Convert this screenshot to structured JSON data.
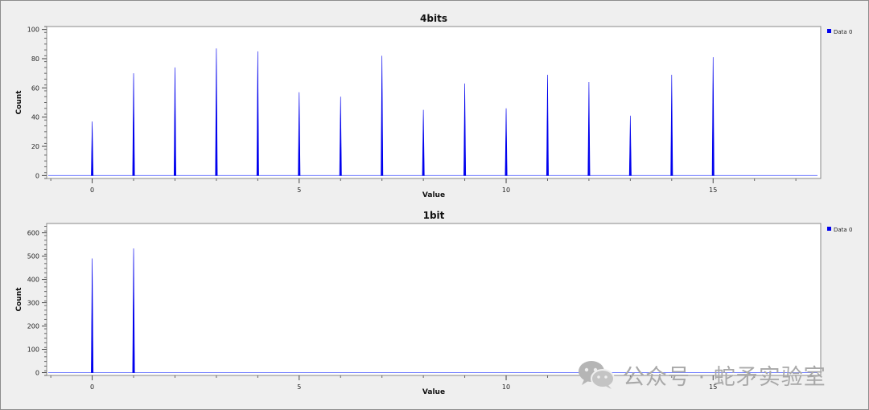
{
  "colors": {
    "series": "#0000ee",
    "baseline": "#6f7cff",
    "legend_marker": "#0000ee"
  },
  "watermark": {
    "icon": "wechat-icon",
    "text": "公众号 · 蛇矛实验室"
  },
  "chart_data": [
    {
      "type": "bar",
      "title": "4bits",
      "xlabel": "Value",
      "ylabel": "Count",
      "legend": [
        "Data 0"
      ],
      "legend_position": "top-right",
      "x_ticks": [
        0,
        5,
        10,
        15
      ],
      "y_ticks": [
        0,
        20,
        40,
        60,
        80,
        100
      ],
      "xlim": [
        -1.1,
        17.6
      ],
      "ylim": [
        -2,
        102
      ],
      "series": [
        {
          "name": "Data 0",
          "x": [
            0,
            1,
            2,
            3,
            4,
            5,
            6,
            7,
            8,
            9,
            10,
            11,
            12,
            13,
            14,
            15
          ],
          "values": [
            37,
            70,
            74,
            87,
            85,
            57,
            54,
            82,
            45,
            63,
            46,
            69,
            64,
            41,
            69,
            81
          ]
        }
      ]
    },
    {
      "type": "bar",
      "title": "1bit",
      "xlabel": "Value",
      "ylabel": "Count",
      "legend": [
        "Data 0"
      ],
      "legend_position": "top-right",
      "x_ticks": [
        0,
        5,
        10,
        15
      ],
      "y_ticks": [
        0,
        100,
        200,
        300,
        400,
        500,
        600
      ],
      "xlim": [
        -1.1,
        17.6
      ],
      "ylim": [
        -12,
        640
      ],
      "series": [
        {
          "name": "Data 0",
          "x": [
            0,
            1
          ],
          "values": [
            490,
            533
          ]
        }
      ]
    }
  ]
}
